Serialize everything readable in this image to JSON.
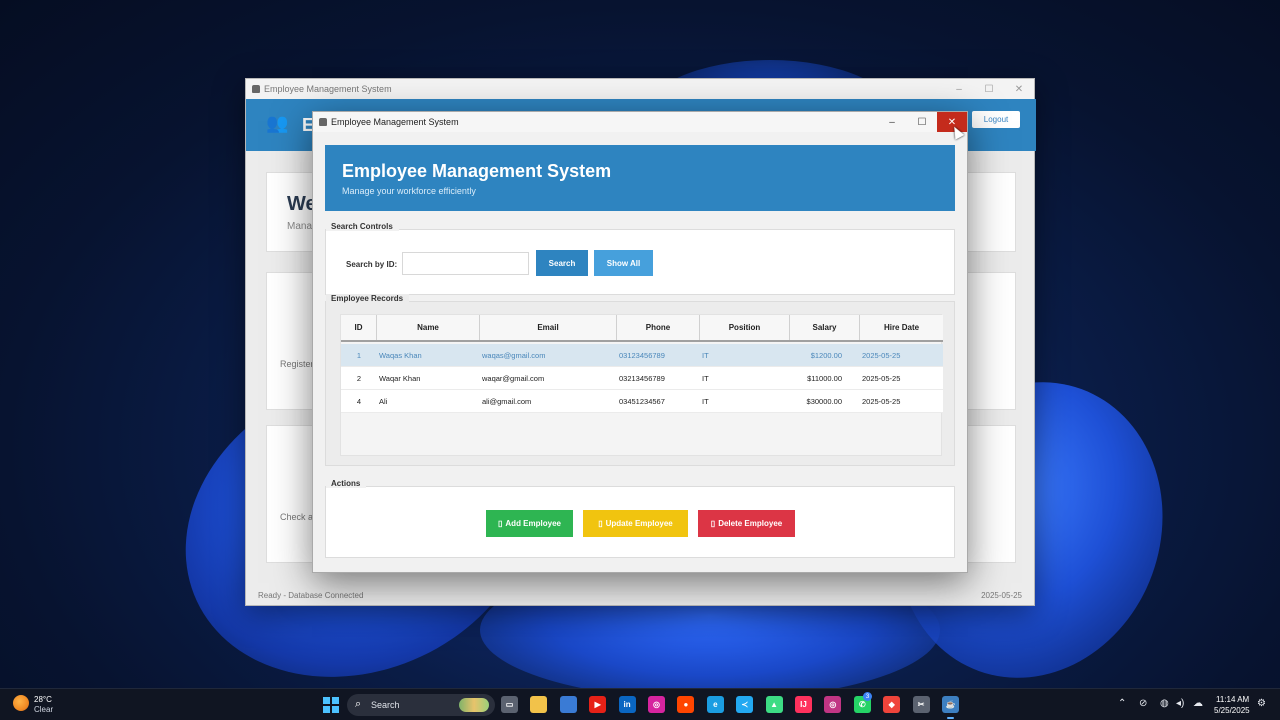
{
  "back_window": {
    "title": "Employee Management System",
    "header_title": "E",
    "logout_label": "Logout",
    "welcome": "We",
    "welcome_sub": "Mana",
    "card2_text": "Register",
    "card3_text": "Check a",
    "status_left": "Ready - Database Connected",
    "status_right": "2025-05-25",
    "ctrl_min": "–",
    "ctrl_max": "☐",
    "ctrl_close": "✕"
  },
  "front_window": {
    "title": "Employee Management System",
    "ctrl_min": "–",
    "ctrl_max": "☐",
    "ctrl_close": "✕",
    "header": {
      "title": "Employee Management System",
      "subtitle": "Manage your workforce efficiently"
    },
    "search": {
      "legend": "Search Controls",
      "label": "Search by ID:",
      "input_value": "",
      "search_button": "Search",
      "show_all_button": "Show All"
    },
    "records": {
      "legend": "Employee Records",
      "columns": [
        "ID",
        "Name",
        "Email",
        "Phone",
        "Position",
        "Salary",
        "Hire Date"
      ],
      "rows": [
        {
          "id": "1",
          "name": "Waqas Khan",
          "email": "waqas@gmail.com",
          "phone": "03123456789",
          "position": "IT",
          "salary": "$1200.00",
          "hire_date": "2025-05-25",
          "selected": true
        },
        {
          "id": "2",
          "name": "Waqar Khan",
          "email": "waqar@gmail.com",
          "phone": "03213456789",
          "position": "IT",
          "salary": "$11000.00",
          "hire_date": "2025-05-25",
          "selected": false
        },
        {
          "id": "4",
          "name": "Ali",
          "email": "ali@gmail.com",
          "phone": "03451234567",
          "position": "IT",
          "salary": "$30000.00",
          "hire_date": "2025-05-25",
          "selected": false
        }
      ]
    },
    "actions": {
      "legend": "Actions",
      "add_button": "Add Employee",
      "update_button": "Update Employee",
      "delete_button": "Delete Employee",
      "add_color": "#2eb552",
      "update_color": "#f1c40f",
      "delete_color": "#dc3545"
    }
  },
  "colors": {
    "primary": "#2e84c0",
    "accent_light": "#46a0dc",
    "selected_row": "#d8e6f0",
    "close_red": "#c42b1c"
  },
  "taskbar": {
    "weather_temp": "28°C",
    "weather_desc": "Clear",
    "search_label": "Search",
    "notification_count": "3",
    "time": "11:14 AM",
    "date": "5/25/2025",
    "apps": [
      {
        "name": "task-view-icon",
        "glyph": "▭",
        "color": "#5b6270"
      },
      {
        "name": "file-explorer-icon",
        "glyph": "",
        "color": "#f2c24a"
      },
      {
        "name": "store-icon",
        "glyph": "",
        "color": "#3a7bd5"
      },
      {
        "name": "youtube-icon",
        "glyph": "▶",
        "color": "#e62117"
      },
      {
        "name": "linkedin-icon",
        "glyph": "in",
        "color": "#0a66c2"
      },
      {
        "name": "instagram-icon",
        "glyph": "◎",
        "color": "#d6249f"
      },
      {
        "name": "reddit-icon",
        "glyph": "●",
        "color": "#ff4500"
      },
      {
        "name": "edge-icon",
        "glyph": "e",
        "color": "#1b9de2"
      },
      {
        "name": "vscode-icon",
        "glyph": "≺",
        "color": "#23a9f2"
      },
      {
        "name": "android-studio-icon",
        "glyph": "▲",
        "color": "#3ddc84"
      },
      {
        "name": "intellij-icon",
        "glyph": "IJ",
        "color": "#fe315d"
      },
      {
        "name": "instagram-2-icon",
        "glyph": "◎",
        "color": "#c13584"
      },
      {
        "name": "whatsapp-icon",
        "glyph": "✆",
        "color": "#25d366"
      },
      {
        "name": "anydesk-icon",
        "glyph": "◆",
        "color": "#ef443b"
      },
      {
        "name": "snipping-tool-icon",
        "glyph": "✂",
        "color": "#5b6270"
      },
      {
        "name": "java-app-icon",
        "glyph": "☕",
        "color": "#3d7fc1"
      }
    ]
  }
}
